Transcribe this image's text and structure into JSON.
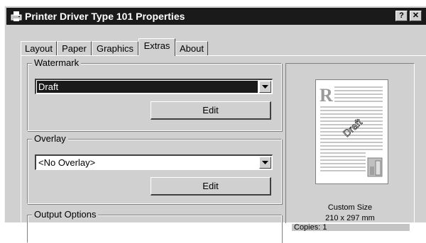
{
  "window": {
    "title": "Printer Driver Type 101 Properties",
    "help_label": "?",
    "close_label": "✕"
  },
  "tabs": [
    {
      "label": "Layout",
      "active": false
    },
    {
      "label": "Paper",
      "active": false
    },
    {
      "label": "Graphics",
      "active": false
    },
    {
      "label": "Extras",
      "active": true
    },
    {
      "label": "About",
      "active": false
    }
  ],
  "watermark": {
    "group_label": "Watermark",
    "selected_value": "Draft",
    "edit_label": "Edit"
  },
  "overlay": {
    "group_label": "Overlay",
    "selected_value": "<No Overlay>",
    "edit_label": "Edit"
  },
  "output_options": {
    "group_label": "Output Options"
  },
  "preview": {
    "logo_letter": "R",
    "watermark_text": "Draft",
    "size_name": "Custom Size",
    "size_dims": "210 x 297 mm",
    "copies_text": "Copies: 1"
  },
  "colors": {
    "title_bar": "#1a1a1a",
    "dialog_face": "#d0d0d0",
    "selection": "#1a1a1a"
  },
  "icons": {
    "title": "printer-icon",
    "dropdown": "chevron-down-icon"
  }
}
